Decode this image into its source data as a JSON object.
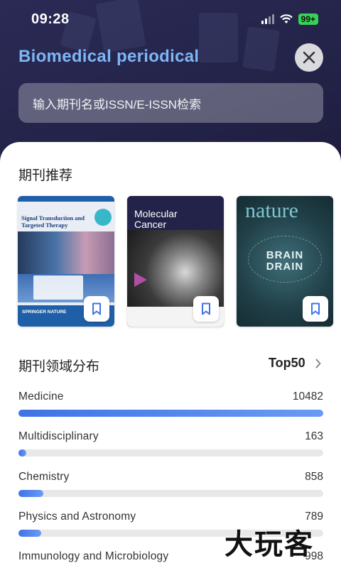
{
  "status_bar": {
    "time": "09:28",
    "battery": "99+"
  },
  "header": {
    "title": "Biomedical periodical",
    "search_placeholder": "输入期刊名或ISSN/E-ISSN检索"
  },
  "recommend": {
    "title": "期刊推荐",
    "covers": [
      {
        "heading": "Signal Transduction and Targeted Therapy",
        "publisher": "SPRINGER NATURE"
      },
      {
        "heading": "Molecular Cancer"
      },
      {
        "heading": "nature",
        "subtitle": "BRAIN DRAIN"
      }
    ]
  },
  "distribution": {
    "title": "期刊领域分布",
    "top_label": "Top50",
    "max_count": 10482,
    "items": [
      {
        "name": "Medicine",
        "count": "10482",
        "value": 10482
      },
      {
        "name": "Multidisciplinary",
        "count": "163",
        "value": 163
      },
      {
        "name": "Chemistry",
        "count": "858",
        "value": 858
      },
      {
        "name": "Physics and Astronomy",
        "count": "789",
        "value": 789
      },
      {
        "name": "Immunology and Microbiology",
        "count": "998",
        "value": 998
      }
    ]
  },
  "watermark": "大玩客",
  "colors": {
    "accent": "#4a7fea",
    "title": "#7db7f5",
    "header_bg": "#24244a"
  }
}
